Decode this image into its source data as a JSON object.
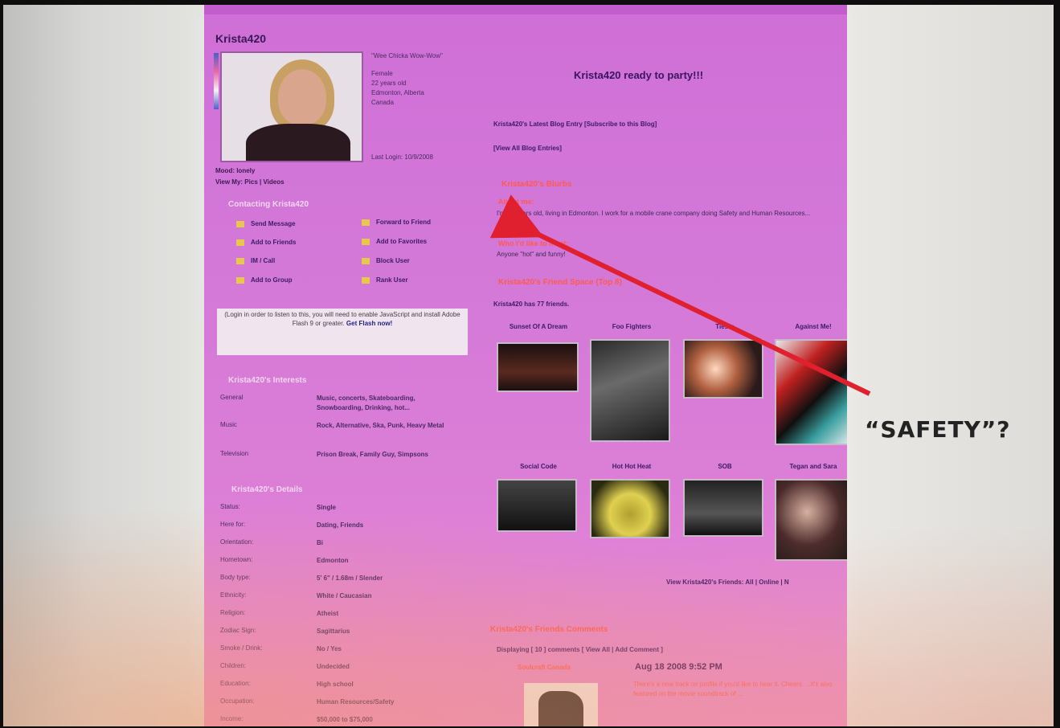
{
  "profile": {
    "username": "Krista420",
    "mood_line": "Mood: lonely",
    "view_my": "View My: Pics | Videos",
    "info_lines": [
      "\"Wee Chicka Wow-Wow\"",
      "Female",
      "22 years old",
      "Edmonton, Alberta",
      "Canada"
    ],
    "last_login": "Last Login: 10/9/2008"
  },
  "contact": {
    "heading": "Contacting Krista420",
    "actions": [
      {
        "label": "Send Message",
        "icon": "envelope-icon"
      },
      {
        "label": "Forward to Friend",
        "icon": "forward-icon"
      },
      {
        "label": "Add to Friends",
        "icon": "add-friend-icon"
      },
      {
        "label": "Add to Favorites",
        "icon": "star-icon"
      },
      {
        "label": "IM / Call",
        "icon": "chat-icon"
      },
      {
        "label": "Block User",
        "icon": "block-icon"
      },
      {
        "label": "Add to Group",
        "icon": "group-icon"
      },
      {
        "label": "Rank User",
        "icon": "rank-icon"
      }
    ]
  },
  "flash_notice": {
    "text": "(Login in order to listen to this, you will need to enable JavaScript and install Adobe Flash 9 or greater.",
    "link": "Get Flash now!"
  },
  "interests": {
    "heading": "Krista420's Interests",
    "rows": [
      {
        "k": "General",
        "v": "Music, concerts, Skateboarding, Snowboarding, Drinking, hot..."
      },
      {
        "k": "Music",
        "v": "Rock, Alternative, Ska, Punk, Heavy Metal"
      },
      {
        "k": "Television",
        "v": "Prison Break, Family Guy, Simpsons"
      }
    ]
  },
  "details": {
    "heading": "Krista420's Details",
    "rows": [
      {
        "k": "Status:",
        "v": "Single"
      },
      {
        "k": "Here for:",
        "v": "Dating, Friends"
      },
      {
        "k": "Orientation:",
        "v": "Bi"
      },
      {
        "k": "Hometown:",
        "v": "Edmonton"
      },
      {
        "k": "Body type:",
        "v": "5' 6\" / 1.68m / Slender"
      },
      {
        "k": "Ethnicity:",
        "v": "White / Caucasian"
      },
      {
        "k": "Religion:",
        "v": "Atheist"
      },
      {
        "k": "Zodiac Sign:",
        "v": "Sagittarius"
      },
      {
        "k": "Smoke / Drink:",
        "v": "No / Yes"
      },
      {
        "k": "Children:",
        "v": "Undecided"
      },
      {
        "k": "Education:",
        "v": "High school"
      },
      {
        "k": "Occupation:",
        "v": "Human Resources/Safety"
      },
      {
        "k": "Income:",
        "v": "$50,000 to $75,000"
      }
    ]
  },
  "main": {
    "headline": "Krista420 ready to party!!!",
    "blog_line": "Krista420's Latest Blog Entry  [Subscribe to this Blog]",
    "view_all_blog": "[View All Blog Entries]",
    "blurbs_heading": "Krista420's Blurbs",
    "about_heading": "About me:",
    "about_text": "I'm 22 years old, living in Edmonton. I work for a mobile crane company doing Safety and Human Resources...",
    "meet_heading": "Who I'd like to meet:",
    "meet_text": "Anyone \"hot\" and funny!",
    "friend_space_heading": "Krista420's Friend Space (Top 8)",
    "has_friends": "Krista420 has 77 friends.",
    "friends": [
      {
        "name": "Sunset Of A Dream"
      },
      {
        "name": "Foo Fighters"
      },
      {
        "name": "Tiesto"
      },
      {
        "name": "Against Me!"
      },
      {
        "name": "Social Code"
      },
      {
        "name": "Hot Hot Heat"
      },
      {
        "name": "SOB"
      },
      {
        "name": "Tegan and Sara"
      }
    ],
    "view_friends": "View Krista420's Friends: All | Online | N",
    "comments_heading": "Krista420's Friends Comments",
    "displaying": "Displaying  [ 10 ]  comments  [ View All | Add Comment ]",
    "commenter": "Soulcraft Canada",
    "comment_date": "Aug 18 2008 9:52 PM",
    "comment_text": "There's a new track on profile if you'd like to hear it. Cheers. ...it's also featured on the movie soundtrack of ..."
  },
  "annotation": {
    "label": "“SAFETY”?",
    "arrow_color": "#e0202e"
  }
}
